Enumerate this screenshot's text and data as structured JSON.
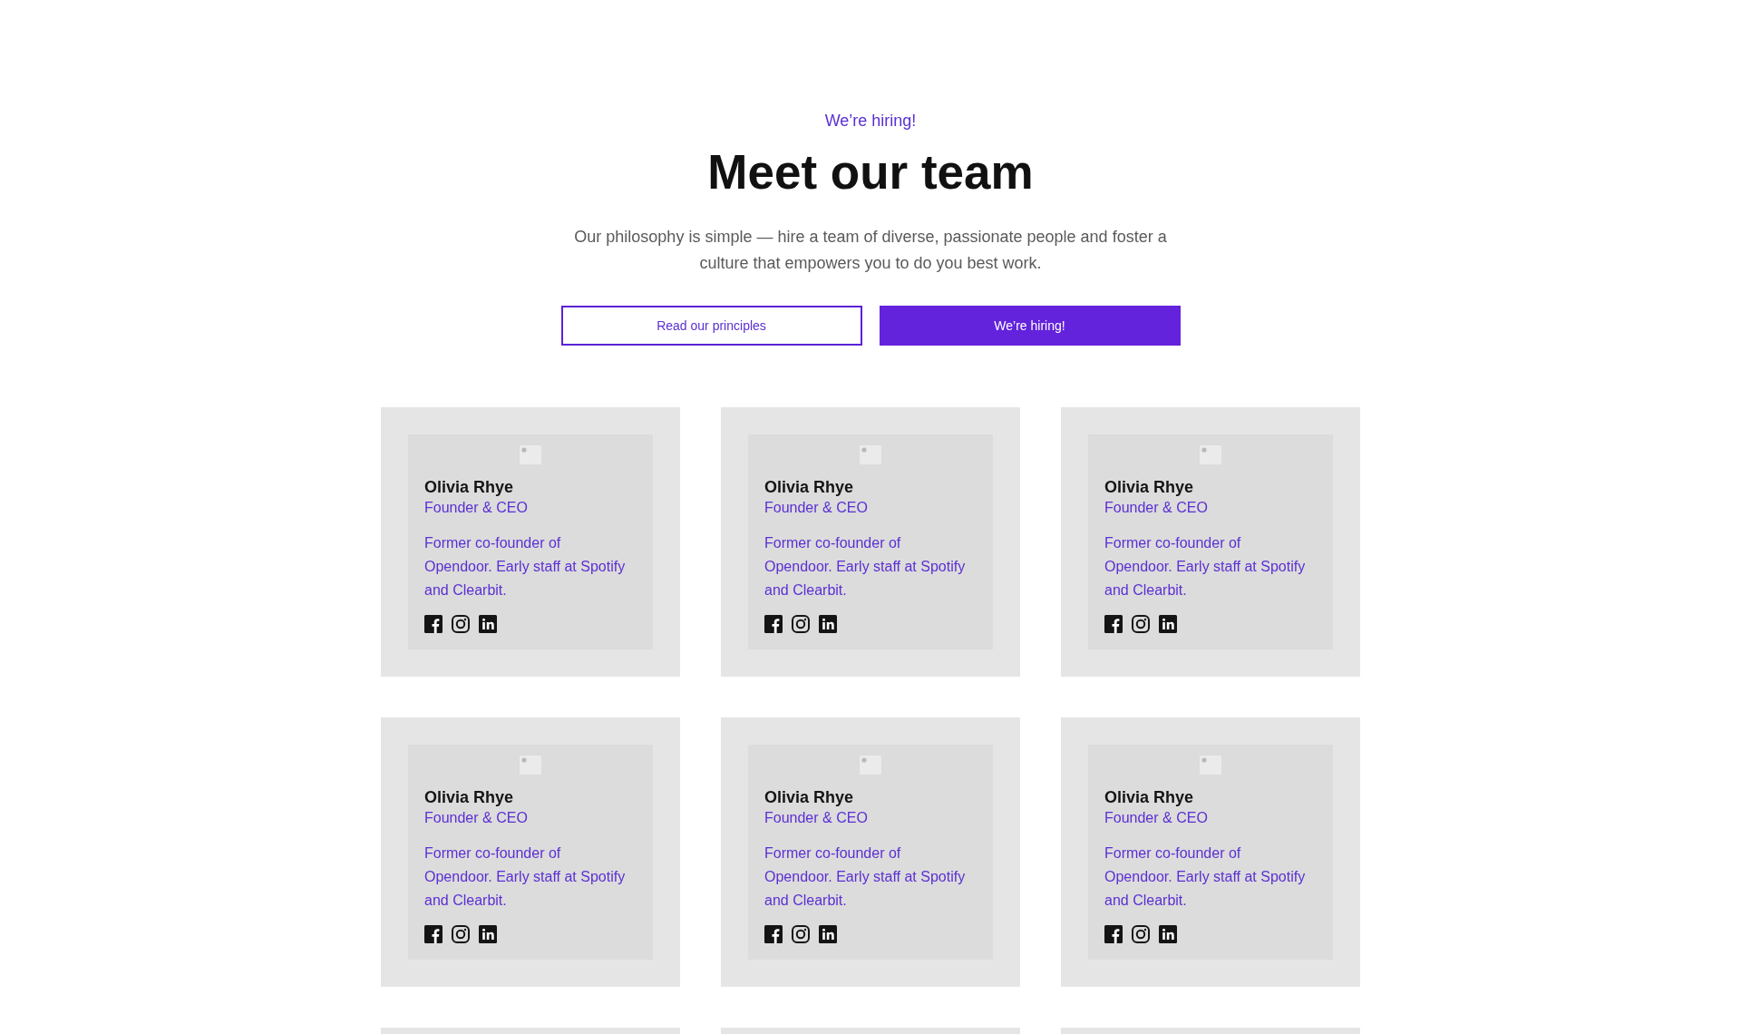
{
  "header": {
    "eyebrow": "We’re hiring!",
    "title": "Meet our team",
    "description": "Our philosophy is simple — hire a team of diverse, passionate people and foster a culture that empowers you to do you best work."
  },
  "buttons": [
    {
      "label": "Read our principles",
      "kind": "outline"
    },
    {
      "label": "We’re hiring!",
      "kind": "primary"
    }
  ],
  "team": [
    {
      "kind": "member",
      "name": "Olivia Rhye",
      "role": "Founder & CEO",
      "bio": "Former co-founder of Opendoor. Early staff at Spotify and Clearbit."
    },
    {
      "kind": "member",
      "name": "Olivia Rhye",
      "role": "Founder & CEO",
      "bio": "Former co-founder of Opendoor. Early staff at Spotify and Clearbit."
    },
    {
      "kind": "member",
      "name": "Olivia Rhye",
      "role": "Founder & CEO",
      "bio": "Former co-founder of Opendoor. Early staff at Spotify and Clearbit."
    },
    {
      "kind": "member",
      "name": "Olivia Rhye",
      "role": "Founder & CEO",
      "bio": "Former co-founder of Opendoor. Early staff at Spotify and Clearbit."
    },
    {
      "kind": "member",
      "name": "Olivia Rhye",
      "role": "Founder & CEO",
      "bio": "Former co-founder of Opendoor. Early staff at Spotify and Clearbit."
    },
    {
      "kind": "member",
      "name": "Olivia Rhye",
      "role": "Founder & CEO",
      "bio": "Former co-founder of Opendoor. Early staff at Spotify and Clearbit."
    },
    {
      "kind": "cut-off"
    },
    {
      "kind": "cut-off"
    },
    {
      "kind": "cut-off"
    }
  ]
}
